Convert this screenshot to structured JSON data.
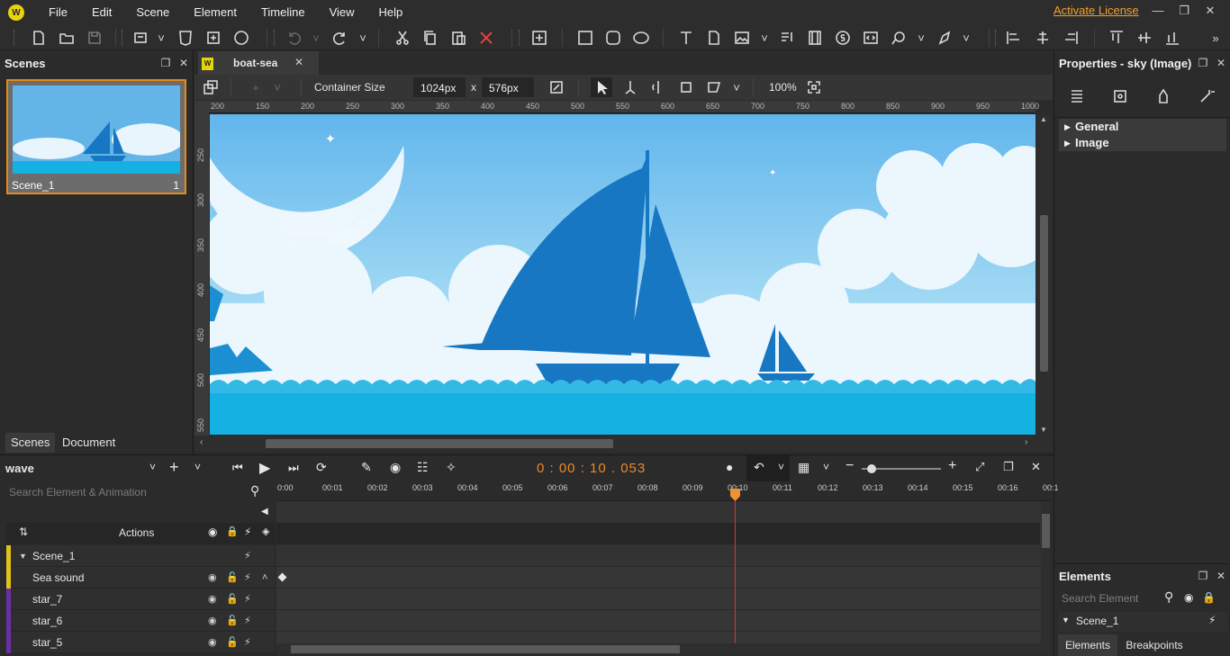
{
  "menu": [
    "File",
    "Edit",
    "Scene",
    "Element",
    "Timeline",
    "View",
    "Help"
  ],
  "activate_license": "Activate License",
  "left_panel": {
    "title": "Scenes",
    "scene": {
      "name": "Scene_1",
      "number": "1"
    },
    "bottom_tabs": [
      "Scenes",
      "Document"
    ]
  },
  "document": {
    "tab_title": "boat-sea",
    "container_size_label": "Container Size",
    "width_value": "1024px",
    "x_sep": "x",
    "height_value": "576px",
    "zoom": "100%"
  },
  "ruler": {
    "top": [
      "200",
      "150",
      "200",
      "250",
      "300",
      "350",
      "400",
      "450",
      "500",
      "550",
      "600",
      "650",
      "700",
      "750",
      "800",
      "850",
      "900",
      "950",
      "1000"
    ],
    "left": [
      "250",
      "300",
      "350",
      "400",
      "450",
      "500",
      "550"
    ]
  },
  "right_panel": {
    "title": "Properties - sky (Image)",
    "sections": [
      "General",
      "Image"
    ]
  },
  "elements_panel": {
    "title": "Elements",
    "search_placeholder": "Search Element",
    "root": "Scene_1",
    "tabs": [
      "Elements",
      "Breakpoints"
    ]
  },
  "timeline": {
    "animation_name": "wave",
    "timecode": "0 : 00 : 10 . 053",
    "search_placeholder": "Search Element & Animation",
    "actions_label": "Actions",
    "ticks": [
      "0:00",
      "00:01",
      "00:02",
      "00:03",
      "00:04",
      "00:05",
      "00:06",
      "00:07",
      "00:08",
      "00:09",
      "00:10",
      "00:11",
      "00:12",
      "00:13",
      "00:14",
      "00:15",
      "00:16",
      "00:1"
    ],
    "layers": [
      {
        "name": "Scene_1",
        "color": "#e0c21a",
        "indent": false
      },
      {
        "name": "Sea sound",
        "color": "#e0c21a",
        "indent": true
      },
      {
        "name": "star_7",
        "color": "#6a2fa8",
        "indent": true
      },
      {
        "name": "star_6",
        "color": "#6a2fa8",
        "indent": true
      },
      {
        "name": "star_5",
        "color": "#6a2fa8",
        "indent": true
      }
    ]
  },
  "colors": {
    "accent": "#e8892a",
    "playhead": "#e03030",
    "sail": "#1777c2",
    "sea": "#15b1e3"
  }
}
